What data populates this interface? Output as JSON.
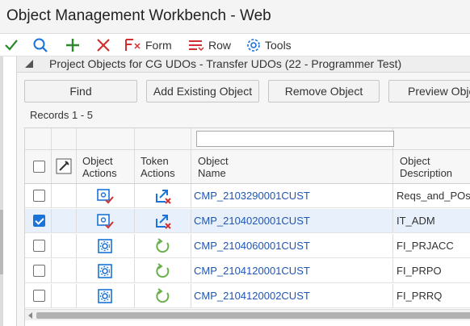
{
  "window": {
    "title": "Object Management Workbench - Web"
  },
  "toolbar": {
    "icons": [
      "check-icon",
      "search-icon",
      "plus-icon",
      "close-icon"
    ],
    "form_label": "Form",
    "row_label": "Row",
    "tools_label": "Tools"
  },
  "form": {
    "header": "Project Objects for CG UDOs - Transfer UDOs (22    - Programmer Test)",
    "buttons": {
      "find": "Find",
      "add_existing": "Add Existing Object",
      "remove": "Remove Object",
      "preview": "Preview Obje"
    },
    "records": "Records 1 - 5"
  },
  "grid": {
    "headers": {
      "object_actions": [
        "Object",
        "Actions"
      ],
      "token_actions": [
        "Token",
        "Actions"
      ],
      "object_name": [
        "Object",
        "Name"
      ],
      "object_description": [
        "Object",
        "Description"
      ]
    },
    "rows": [
      {
        "name": "CMP_2103290001CUST",
        "description": "Reqs_and_POs",
        "selected": false,
        "object_icon": "object-checked-icon",
        "token_icon": "token-release-icon"
      },
      {
        "name": "CMP_2104020001CUST",
        "description": "IT_ADM",
        "selected": true,
        "object_icon": "object-checked-icon",
        "token_icon": "token-release-icon"
      },
      {
        "name": "CMP_2104060001CUST",
        "description": "FI_PRJACC",
        "selected": false,
        "object_icon": "object-gear-icon",
        "token_icon": "token-refresh-icon"
      },
      {
        "name": "CMP_2104120001CUST",
        "description": "FI_PRPO",
        "selected": false,
        "object_icon": "object-gear-icon",
        "token_icon": "token-refresh-icon"
      },
      {
        "name": "CMP_2104120002CUST",
        "description": "FI_PRRQ",
        "selected": false,
        "object_icon": "object-gear-icon",
        "token_icon": "token-refresh-icon"
      }
    ]
  },
  "colors": {
    "link": "#1f56b4",
    "accent": "#1a73d9",
    "check_green": "#2a8a2a",
    "close_red": "#d23030"
  }
}
